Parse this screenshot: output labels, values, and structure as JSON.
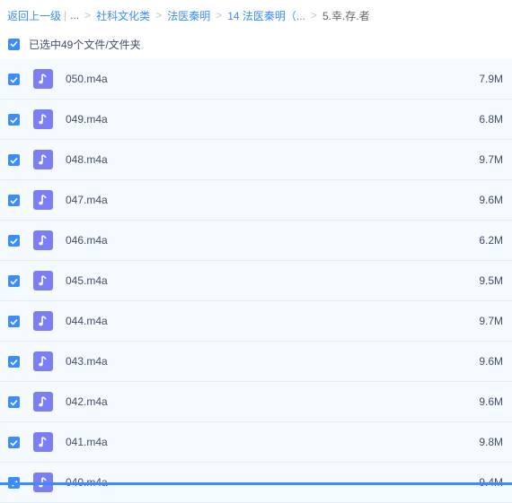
{
  "breadcrumb": {
    "back": "返回上一级",
    "ellipsis": "...",
    "items": [
      "社科文化类",
      "法医秦明",
      "14 法医秦明（..."
    ],
    "current": "5.幸.存.者"
  },
  "selection": {
    "label": "已选中49个文件/文件夹"
  },
  "files": [
    {
      "name": "050.m4a",
      "size": "7.9M"
    },
    {
      "name": "049.m4a",
      "size": "6.8M"
    },
    {
      "name": "048.m4a",
      "size": "9.7M"
    },
    {
      "name": "047.m4a",
      "size": "9.6M"
    },
    {
      "name": "046.m4a",
      "size": "6.2M"
    },
    {
      "name": "045.m4a",
      "size": "9.5M"
    },
    {
      "name": "044.m4a",
      "size": "9.7M"
    },
    {
      "name": "043.m4a",
      "size": "9.6M"
    },
    {
      "name": "042.m4a",
      "size": "9.6M"
    },
    {
      "name": "041.m4a",
      "size": "9.8M"
    },
    {
      "name": "040.m4a",
      "size": "9.4M"
    }
  ],
  "colors": {
    "accent": "#3b8cff",
    "audio_icon": "#7b7ff3",
    "row_bg": "#f5fafe"
  }
}
